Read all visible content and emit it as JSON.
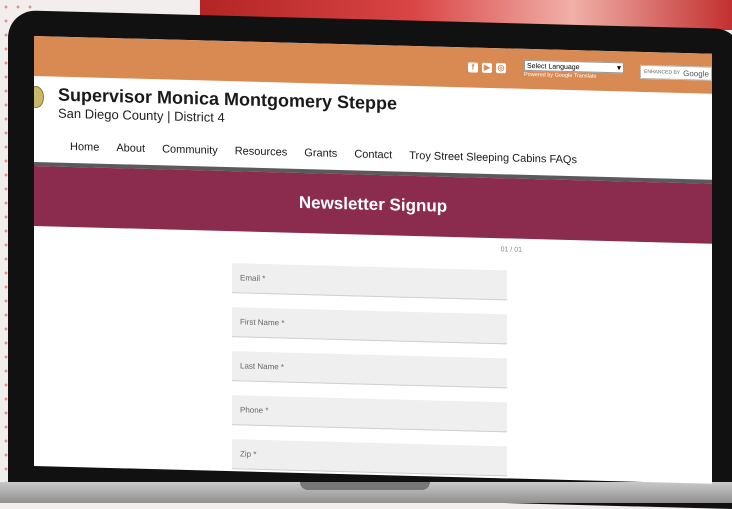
{
  "topbar": {
    "social_icons": [
      "facebook-icon",
      "youtube-icon",
      "instagram-icon"
    ],
    "language_select": "Select Language",
    "powered_by": "Powered by Google Translate",
    "search_label": "ENHANCED BY",
    "search_brand": "Google"
  },
  "header": {
    "title": "Supervisor Monica Montgomery Steppe",
    "subtitle": "San Diego County | District 4"
  },
  "nav": {
    "items": [
      {
        "label": "Home"
      },
      {
        "label": "About"
      },
      {
        "label": "Community"
      },
      {
        "label": "Resources"
      },
      {
        "label": "Grants"
      },
      {
        "label": "Contact"
      },
      {
        "label": "Troy Street Sleeping Cabins FAQs"
      }
    ]
  },
  "banner": {
    "title": "Newsletter Signup"
  },
  "form": {
    "pager": "01 / 01",
    "fields": [
      {
        "placeholder": "Email *"
      },
      {
        "placeholder": "First Name *"
      },
      {
        "placeholder": "Last Name *"
      },
      {
        "placeholder": "Phone *"
      },
      {
        "placeholder": "Zip *"
      }
    ]
  },
  "colors": {
    "topbar": "#d98a52",
    "banner": "#8b2c4f"
  }
}
